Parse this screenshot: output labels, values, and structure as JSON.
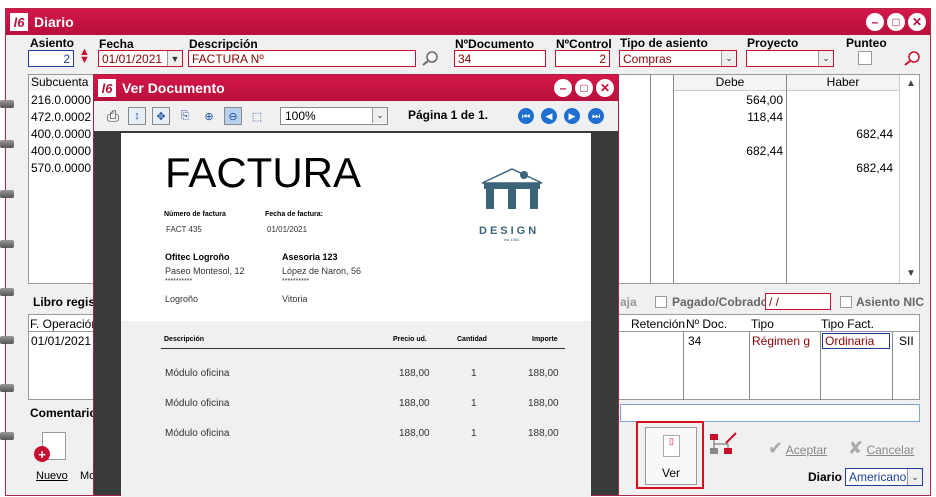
{
  "main": {
    "title": "Diario",
    "logo": "l6",
    "window_controls": [
      "–",
      "□",
      "✕"
    ]
  },
  "header": {
    "asiento_label": "Asiento",
    "asiento_value": "2",
    "fecha_label": "Fecha",
    "fecha_value": "01/01/2021",
    "descripcion_label": "Descripción",
    "descripcion_value": "FACTURA Nº",
    "ndoc_label": "NºDocumento",
    "ndoc_value": "34",
    "ncontrol_label": "NºControl",
    "ncontrol_value": "2",
    "tipo_label": "Tipo de asiento",
    "tipo_value": "Compras",
    "proyecto_label": "Proyecto",
    "proyecto_value": "",
    "punteo_label": "Punteo"
  },
  "entries": {
    "col_subcuenta": "Subcuenta",
    "col_debe": "Debe",
    "col_haber": "Haber",
    "subcuentas": [
      "216.0.0000",
      "472.0.0002",
      "400.0.0000",
      "400.0.0000",
      "570.0.0000"
    ],
    "debe": [
      "564,00",
      "118,44",
      "",
      "682,44",
      ""
    ],
    "haber": [
      "",
      "",
      "682,44",
      "",
      "682,44"
    ]
  },
  "libro": {
    "label": "Libro regis",
    "caja_label": "aja",
    "pagado_label": "Pagado/Cobrado",
    "pagado_value": " / /",
    "asiento_nic_label": "Asiento NIC",
    "cols": {
      "foperacion": "F. Operación",
      "retencion": "Retención",
      "ndoc": "Nº Doc.",
      "tipo": "Tipo",
      "tipo_fact": "Tipo Fact."
    },
    "row": {
      "foperacion": "01/01/2021",
      "ndoc": "34",
      "tipo": "Régimen g",
      "tipo_fact": "Ordinaria",
      "sii": "SII"
    }
  },
  "comentarios_label": "Comentario",
  "toolbar": {
    "nuevo_label": "Nuevo",
    "mo_label": "Mo",
    "ver_label": "Ver",
    "aceptar_label": "Aceptar",
    "cancelar_label": "Cancelar",
    "diario_label": "Diario",
    "diario_value": "Americano"
  },
  "doc_viewer": {
    "title": "Ver Documento",
    "zoom": "100%",
    "page_info": "Página 1 de 1.",
    "invoice": {
      "heading": "FACTURA",
      "logo_text": "DESIGN",
      "logo_sub": "est 1980",
      "num_label": "Número de factura",
      "num_value": "FACT 435",
      "fecha_label": "Fecha de factura:",
      "fecha_value": "01/01/2021",
      "from_name": "Ofitec Logroño",
      "from_addr": "Paseo Montesol, 12",
      "from_stars": "**********",
      "from_city": "Logroño",
      "to_name": "Asesoria 123",
      "to_addr": "López de Naron, 56",
      "to_stars": "**********",
      "to_city": "Vitoria",
      "col_desc": "Descripción",
      "col_precio": "Precio ud.",
      "col_cant": "Cantidad",
      "col_importe": "Importe",
      "lines": [
        {
          "desc": "Módulo oficina",
          "precio": "188,00",
          "cant": "1",
          "importe": "188,00"
        },
        {
          "desc": "Módulo oficina",
          "precio": "188,00",
          "cant": "1",
          "importe": "188,00"
        },
        {
          "desc": "Módulo oficina",
          "precio": "188,00",
          "cant": "1",
          "importe": "188,00"
        }
      ]
    }
  },
  "colors": {
    "brand": "#c8102e",
    "title_bar": "#b80f3c",
    "nav_blue": "#1f6fd0"
  }
}
